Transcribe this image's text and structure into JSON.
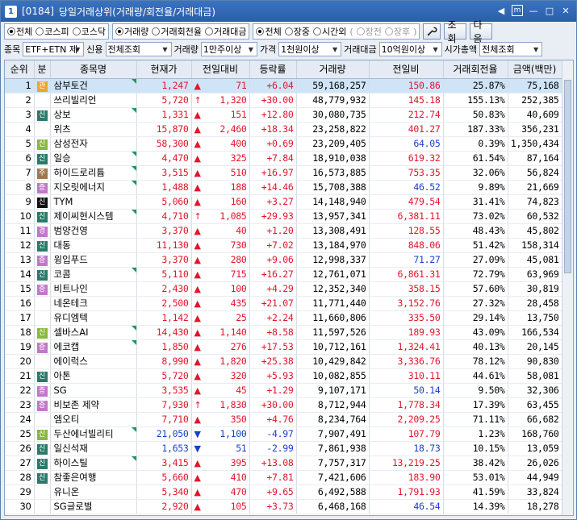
{
  "window": {
    "num": "1",
    "code": "[0184]",
    "title": "당일거래상위(거래량/회전율/거래대금)"
  },
  "titlebar_controls": {
    "left_arrow": "◀",
    "restore": "m",
    "minimize": "—",
    "maximize": "□",
    "close": "✕"
  },
  "market_filter": {
    "options": [
      "전체",
      "코스피",
      "코스닥"
    ],
    "selected": 0
  },
  "sort_filter": {
    "options": [
      "거래량",
      "거래회전율",
      "거래대금"
    ],
    "selected": 0
  },
  "session_filter": {
    "options": [
      "전체",
      "장중",
      "시간외"
    ],
    "selected": 0,
    "sub": [
      "장전",
      "장후"
    ],
    "sub_prefix": "(",
    "sub_suffix": ")"
  },
  "buttons": {
    "query": "조회",
    "next": "다음",
    "settings_icon": "wrench-icon"
  },
  "filters": {
    "stock_label": "종목",
    "stock_value": "ETF+ETN 제",
    "credit_label": "신용",
    "credit_value": "전체조회",
    "volume_label": "거래량",
    "volume_value": "1만주이상",
    "price_label": "가격",
    "price_value": "1천원이상",
    "amount_label": "거래대금",
    "amount_value": "10억원이상",
    "cap_label": "시가총액",
    "cap_value": "전체조회"
  },
  "table": {
    "headers": [
      "순위",
      "분",
      "종목명",
      "현재가",
      "전일대비",
      "등락률",
      "거래량",
      "전일비",
      "거래회전율",
      "금액(백만)"
    ],
    "rows": [
      {
        "rank": "1",
        "cls": "관",
        "cls_color": "#f0a52a",
        "name": "삼부토건",
        "flag": true,
        "price": "1,247",
        "dir": "up",
        "sym": "▲",
        "chg": "71",
        "rate": "+6.04",
        "vol": "59,168,257",
        "prev": "150.86",
        "prev_dir": "up",
        "turn": "25.87%",
        "amt": "75,168",
        "sel": true
      },
      {
        "rank": "2",
        "cls": "",
        "cls_color": "",
        "name": "쓰리빌리언",
        "flag": false,
        "price": "5,720",
        "dir": "up",
        "sym": "↑",
        "chg": "1,320",
        "rate": "+30.00",
        "vol": "48,779,932",
        "prev": "145.18",
        "prev_dir": "up",
        "turn": "155.13%",
        "amt": "252,385"
      },
      {
        "rank": "3",
        "cls": "신",
        "cls_color": "#2a7a6a",
        "name": "상보",
        "flag": true,
        "price": "1,331",
        "dir": "up",
        "sym": "▲",
        "chg": "151",
        "rate": "+12.80",
        "vol": "30,080,735",
        "prev": "212.74",
        "prev_dir": "up",
        "turn": "50.83%",
        "amt": "40,609"
      },
      {
        "rank": "4",
        "cls": "",
        "cls_color": "",
        "name": "위츠",
        "flag": false,
        "price": "15,870",
        "dir": "up",
        "sym": "▲",
        "chg": "2,460",
        "rate": "+18.34",
        "vol": "23,258,822",
        "prev": "401.27",
        "prev_dir": "up",
        "turn": "187.33%",
        "amt": "356,231"
      },
      {
        "rank": "5",
        "cls": "신",
        "cls_color": "#8ab840",
        "name": "삼성전자",
        "flag": false,
        "price": "58,300",
        "dir": "up",
        "sym": "▲",
        "chg": "400",
        "rate": "+0.69",
        "vol": "23,209,405",
        "prev": "64.05",
        "prev_dir": "down",
        "turn": "0.39%",
        "amt": "1,350,434"
      },
      {
        "rank": "6",
        "cls": "신",
        "cls_color": "#2a7a6a",
        "name": "일승",
        "flag": true,
        "price": "4,470",
        "dir": "up",
        "sym": "▲",
        "chg": "325",
        "rate": "+7.84",
        "vol": "18,910,038",
        "prev": "619.32",
        "prev_dir": "up",
        "turn": "61.54%",
        "amt": "87,164"
      },
      {
        "rank": "7",
        "cls": "주",
        "cls_color": "#a07850",
        "name": "하이드로리튬",
        "flag": true,
        "price": "3,515",
        "dir": "up",
        "sym": "▲",
        "chg": "510",
        "rate": "+16.97",
        "vol": "16,573,885",
        "prev": "753.35",
        "prev_dir": "up",
        "turn": "32.06%",
        "amt": "56,824"
      },
      {
        "rank": "8",
        "cls": "증",
        "cls_color": "#c078c8",
        "name": "지오릿에너지",
        "flag": true,
        "price": "1,488",
        "dir": "up",
        "sym": "▲",
        "chg": "188",
        "rate": "+14.46",
        "vol": "15,708,388",
        "prev": "46.52",
        "prev_dir": "down",
        "turn": "9.89%",
        "amt": "21,669"
      },
      {
        "rank": "9",
        "cls": "신",
        "cls_color": "#111111",
        "name": "TYM",
        "flag": false,
        "price": "5,060",
        "dir": "up",
        "sym": "▲",
        "chg": "160",
        "rate": "+3.27",
        "vol": "14,148,940",
        "prev": "479.54",
        "prev_dir": "up",
        "turn": "31.41%",
        "amt": "74,823"
      },
      {
        "rank": "10",
        "cls": "신",
        "cls_color": "#2a7a6a",
        "name": "제이씨현시스템",
        "flag": true,
        "price": "4,710",
        "dir": "up",
        "sym": "↑",
        "chg": "1,085",
        "rate": "+29.93",
        "vol": "13,957,341",
        "prev": "6,381.11",
        "prev_dir": "up",
        "turn": "73.02%",
        "amt": "60,532"
      },
      {
        "rank": "11",
        "cls": "경",
        "cls_color": "#c078c8",
        "name": "범양건영",
        "flag": false,
        "price": "3,370",
        "dir": "up",
        "sym": "▲",
        "chg": "40",
        "rate": "+1.20",
        "vol": "13,308,491",
        "prev": "128.55",
        "prev_dir": "up",
        "turn": "48.43%",
        "amt": "45,802"
      },
      {
        "rank": "12",
        "cls": "신",
        "cls_color": "#2a7a6a",
        "name": "대동",
        "flag": false,
        "price": "11,130",
        "dir": "up",
        "sym": "▲",
        "chg": "730",
        "rate": "+7.02",
        "vol": "13,184,970",
        "prev": "848.06",
        "prev_dir": "up",
        "turn": "51.42%",
        "amt": "158,314"
      },
      {
        "rank": "13",
        "cls": "증",
        "cls_color": "#c078c8",
        "name": "윙입푸드",
        "flag": false,
        "price": "3,370",
        "dir": "up",
        "sym": "▲",
        "chg": "280",
        "rate": "+9.06",
        "vol": "12,998,337",
        "prev": "71.27",
        "prev_dir": "down",
        "turn": "27.09%",
        "amt": "45,081"
      },
      {
        "rank": "14",
        "cls": "신",
        "cls_color": "#2a7a6a",
        "name": "코콤",
        "flag": true,
        "price": "5,110",
        "dir": "up",
        "sym": "▲",
        "chg": "715",
        "rate": "+16.27",
        "vol": "12,761,071",
        "prev": "6,861.31",
        "prev_dir": "up",
        "turn": "72.79%",
        "amt": "63,969"
      },
      {
        "rank": "15",
        "cls": "증",
        "cls_color": "#c078c8",
        "name": "비트나인",
        "flag": false,
        "price": "2,430",
        "dir": "up",
        "sym": "▲",
        "chg": "100",
        "rate": "+4.29",
        "vol": "12,352,340",
        "prev": "358.15",
        "prev_dir": "up",
        "turn": "57.60%",
        "amt": "30,819"
      },
      {
        "rank": "16",
        "cls": "",
        "cls_color": "",
        "name": "네온테크",
        "flag": false,
        "price": "2,500",
        "dir": "up",
        "sym": "▲",
        "chg": "435",
        "rate": "+21.07",
        "vol": "11,771,440",
        "prev": "3,152.76",
        "prev_dir": "up",
        "turn": "27.32%",
        "amt": "28,458"
      },
      {
        "rank": "17",
        "cls": "",
        "cls_color": "",
        "name": "유디엠텍",
        "flag": false,
        "price": "1,142",
        "dir": "up",
        "sym": "▲",
        "chg": "25",
        "rate": "+2.24",
        "vol": "11,660,806",
        "prev": "335.50",
        "prev_dir": "up",
        "turn": "29.14%",
        "amt": "13,750"
      },
      {
        "rank": "18",
        "cls": "신",
        "cls_color": "#8ab840",
        "name": "셀바스AI",
        "flag": true,
        "price": "14,430",
        "dir": "up",
        "sym": "▲",
        "chg": "1,140",
        "rate": "+8.58",
        "vol": "11,597,526",
        "prev": "189.93",
        "prev_dir": "up",
        "turn": "43.09%",
        "amt": "166,534"
      },
      {
        "rank": "19",
        "cls": "증",
        "cls_color": "#c078c8",
        "name": "에코캡",
        "flag": true,
        "price": "1,850",
        "dir": "up",
        "sym": "▲",
        "chg": "276",
        "rate": "+17.53",
        "vol": "10,712,161",
        "prev": "1,324.41",
        "prev_dir": "up",
        "turn": "40.13%",
        "amt": "20,145"
      },
      {
        "rank": "20",
        "cls": "",
        "cls_color": "",
        "name": "에이럭스",
        "flag": false,
        "price": "8,990",
        "dir": "up",
        "sym": "▲",
        "chg": "1,820",
        "rate": "+25.38",
        "vol": "10,429,842",
        "prev": "3,336.76",
        "prev_dir": "up",
        "turn": "78.12%",
        "amt": "90,830"
      },
      {
        "rank": "21",
        "cls": "신",
        "cls_color": "#2a7a6a",
        "name": "아톤",
        "flag": false,
        "price": "5,720",
        "dir": "up",
        "sym": "▲",
        "chg": "320",
        "rate": "+5.93",
        "vol": "10,082,855",
        "prev": "310.11",
        "prev_dir": "up",
        "turn": "44.61%",
        "amt": "58,081"
      },
      {
        "rank": "22",
        "cls": "증",
        "cls_color": "#c078c8",
        "name": "SG",
        "flag": false,
        "price": "3,535",
        "dir": "up",
        "sym": "▲",
        "chg": "45",
        "rate": "+1.29",
        "vol": "9,107,171",
        "prev": "50.14",
        "prev_dir": "down",
        "turn": "9.50%",
        "amt": "32,306"
      },
      {
        "rank": "23",
        "cls": "증",
        "cls_color": "#c078c8",
        "name": "비보존 제약",
        "flag": false,
        "price": "7,930",
        "dir": "up",
        "sym": "↑",
        "chg": "1,830",
        "rate": "+30.00",
        "vol": "8,712,944",
        "prev": "1,778.34",
        "prev_dir": "up",
        "turn": "17.39%",
        "amt": "63,455"
      },
      {
        "rank": "24",
        "cls": "",
        "cls_color": "",
        "name": "엠오티",
        "flag": false,
        "price": "7,710",
        "dir": "up",
        "sym": "▲",
        "chg": "350",
        "rate": "+4.76",
        "vol": "8,234,764",
        "prev": "2,209.25",
        "prev_dir": "up",
        "turn": "71.11%",
        "amt": "66,682"
      },
      {
        "rank": "25",
        "cls": "신",
        "cls_color": "#8ab840",
        "name": "두산에너빌리티",
        "flag": true,
        "price": "21,050",
        "dir": "down",
        "sym": "▼",
        "chg": "1,100",
        "rate": "-4.97",
        "vol": "7,907,491",
        "prev": "107.79",
        "prev_dir": "up",
        "turn": "1.23%",
        "amt": "168,760"
      },
      {
        "rank": "26",
        "cls": "신",
        "cls_color": "#2a7a6a",
        "name": "일신석재",
        "flag": false,
        "price": "1,653",
        "dir": "down",
        "sym": "▼",
        "chg": "51",
        "rate": "-2.99",
        "vol": "7,861,938",
        "prev": "18.73",
        "prev_dir": "down",
        "turn": "10.15%",
        "amt": "13,059"
      },
      {
        "rank": "27",
        "cls": "신",
        "cls_color": "#2a7a6a",
        "name": "하이스틸",
        "flag": true,
        "price": "3,415",
        "dir": "up",
        "sym": "▲",
        "chg": "395",
        "rate": "+13.08",
        "vol": "7,757,317",
        "prev": "13,219.25",
        "prev_dir": "up",
        "turn": "38.42%",
        "amt": "26,026"
      },
      {
        "rank": "28",
        "cls": "신",
        "cls_color": "#2a7a6a",
        "name": "참좋은여행",
        "flag": false,
        "price": "5,660",
        "dir": "up",
        "sym": "▲",
        "chg": "410",
        "rate": "+7.81",
        "vol": "7,421,606",
        "prev": "183.90",
        "prev_dir": "up",
        "turn": "53.01%",
        "amt": "44,949"
      },
      {
        "rank": "29",
        "cls": "",
        "cls_color": "",
        "name": "유니온",
        "flag": false,
        "price": "5,340",
        "dir": "up",
        "sym": "▲",
        "chg": "470",
        "rate": "+9.65",
        "vol": "6,492,588",
        "prev": "1,791.93",
        "prev_dir": "up",
        "turn": "41.59%",
        "amt": "33,824"
      },
      {
        "rank": "30",
        "cls": "",
        "cls_color": "",
        "name": "SG글로벌",
        "flag": false,
        "price": "2,920",
        "dir": "up",
        "sym": "▲",
        "chg": "105",
        "rate": "+3.73",
        "vol": "6,468,168",
        "prev": "46.54",
        "prev_dir": "down",
        "turn": "14.39%",
        "amt": "18,278"
      }
    ]
  }
}
